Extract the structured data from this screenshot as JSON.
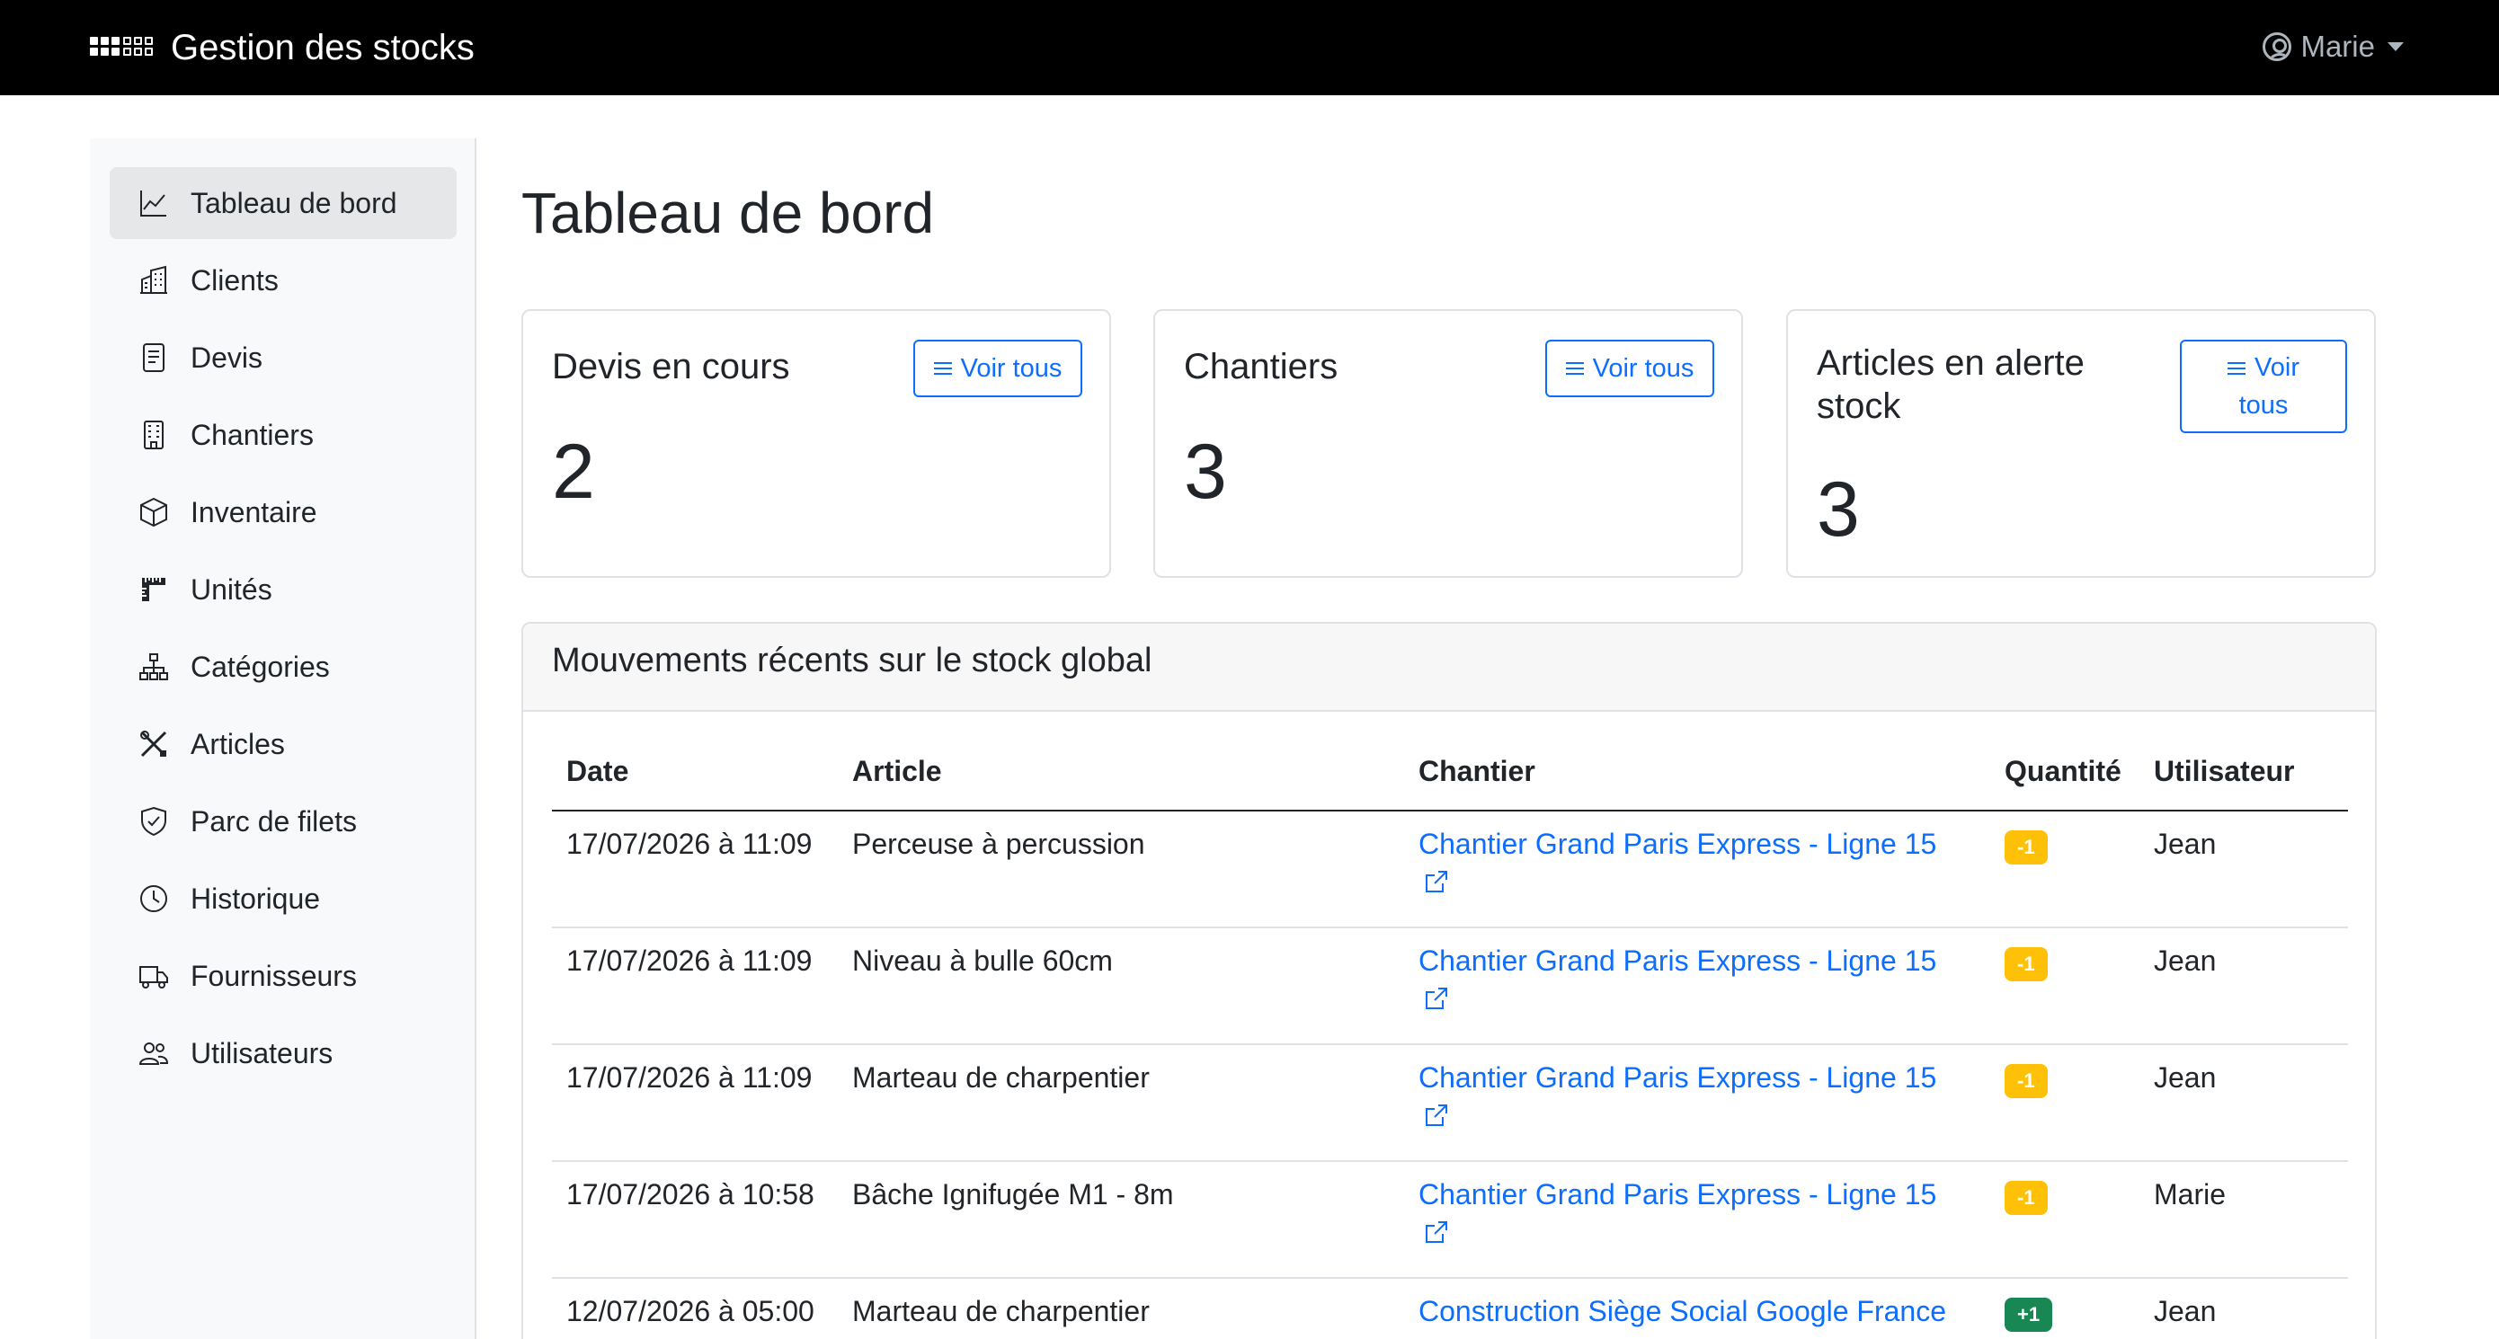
{
  "navbar": {
    "brand": "Gestion des stocks",
    "user": "Marie"
  },
  "sidebar": {
    "items": [
      {
        "label": "Tableau de bord",
        "icon": "chart-line-icon",
        "active": true
      },
      {
        "label": "Clients",
        "icon": "building-icon"
      },
      {
        "label": "Devis",
        "icon": "document-icon"
      },
      {
        "label": "Chantiers",
        "icon": "building-grid-icon"
      },
      {
        "label": "Inventaire",
        "icon": "box-icon"
      },
      {
        "label": "Unités",
        "icon": "ruler-icon"
      },
      {
        "label": "Catégories",
        "icon": "diagram-icon"
      },
      {
        "label": "Articles",
        "icon": "tools-icon"
      },
      {
        "label": "Parc de filets",
        "icon": "shield-icon"
      },
      {
        "label": "Historique",
        "icon": "clock-icon"
      },
      {
        "label": "Fournisseurs",
        "icon": "truck-icon"
      },
      {
        "label": "Utilisateurs",
        "icon": "people-icon"
      }
    ]
  },
  "main": {
    "title": "Tableau de bord",
    "cards": [
      {
        "title": "Devis en cours",
        "value": "2",
        "button": "Voir tous"
      },
      {
        "title": "Chantiers",
        "value": "3",
        "button": "Voir tous"
      },
      {
        "title": "Articles en alerte stock",
        "value": "3",
        "button_line1": "Voir",
        "button_line2": "tous"
      }
    ],
    "movements": {
      "title": "Mouvements récents sur le stock global",
      "headers": {
        "date": "Date",
        "article": "Article",
        "chantier": "Chantier",
        "quantity": "Quantité",
        "user": "Utilisateur"
      },
      "rows": [
        {
          "date": "17/07/2026 à 11:09",
          "article": "Perceuse à percussion",
          "chantier": "Chantier Grand Paris Express - Ligne 15",
          "quantity": "-1",
          "user": "Jean"
        },
        {
          "date": "17/07/2026 à 11:09",
          "article": "Niveau à bulle 60cm",
          "chantier": "Chantier Grand Paris Express - Ligne 15",
          "quantity": "-1",
          "user": "Jean"
        },
        {
          "date": "17/07/2026 à 11:09",
          "article": "Marteau de charpentier",
          "chantier": "Chantier Grand Paris Express - Ligne 15",
          "quantity": "-1",
          "user": "Jean"
        },
        {
          "date": "17/07/2026 à 10:58",
          "article": "Bâche Ignifugée M1 - 8m",
          "chantier": "Chantier Grand Paris Express - Ligne 15",
          "quantity": "-1",
          "user": "Marie"
        },
        {
          "date": "12/07/2026 à 05:00",
          "article": "Marteau de charpentier",
          "chantier": "Construction Siège Social Google France",
          "quantity": "+1",
          "user": "Jean"
        }
      ]
    }
  },
  "colors": {
    "navbar": "#000000",
    "primary": "#0d6efd",
    "warning": "#ffc107",
    "success": "#198754"
  }
}
